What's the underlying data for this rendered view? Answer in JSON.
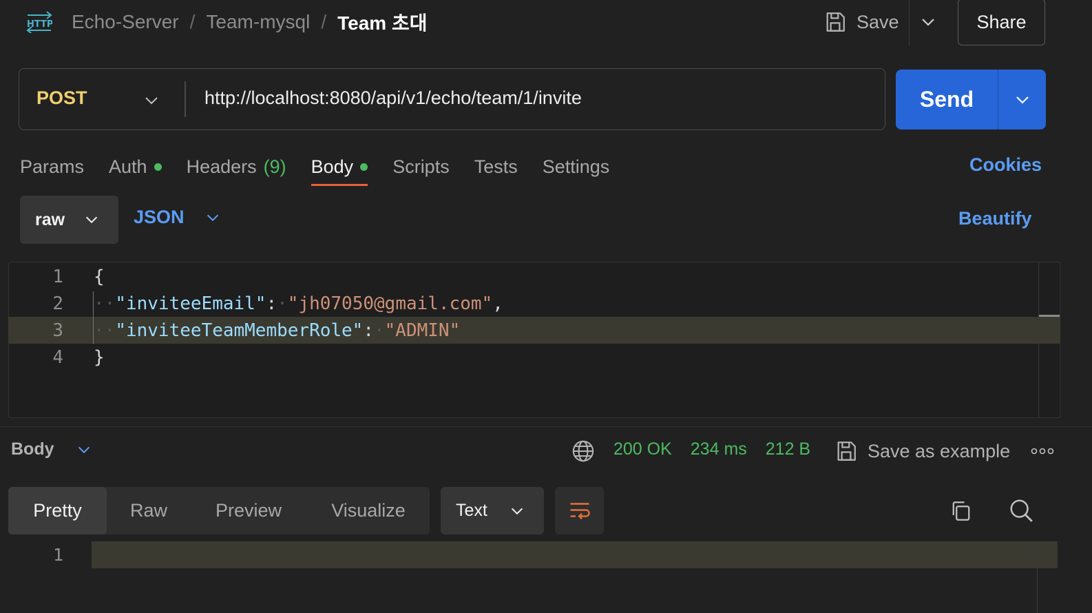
{
  "header": {
    "breadcrumb": [
      "Echo-Server",
      "Team-mysql"
    ],
    "current": "Team 초대",
    "save_label": "Save",
    "share_label": "Share",
    "icon": "http-icon"
  },
  "request": {
    "method": "POST",
    "url": "http://localhost:8080/api/v1/echo/team/1/invite",
    "send_label": "Send"
  },
  "tabs": {
    "params": "Params",
    "auth": "Auth",
    "headers": "Headers",
    "headers_count": "(9)",
    "body": "Body",
    "scripts": "Scripts",
    "tests": "Tests",
    "settings": "Settings",
    "cookies": "Cookies",
    "active": "Body"
  },
  "body_mode": {
    "type": "raw",
    "format": "JSON",
    "beautify": "Beautify"
  },
  "editor": {
    "line_numbers": [
      "1",
      "2",
      "3",
      "4"
    ],
    "open_brace": "{",
    "close_brace": "}",
    "key1": "\"inviteeEmail\"",
    "val1": "\"jh07050@gmail.com\"",
    "key2": "\"inviteeTeamMemberRole\"",
    "val2": "\"ADMIN\""
  },
  "response": {
    "section_label": "Body",
    "status": "200 OK",
    "time": "234 ms",
    "size": "212 B",
    "save_example": "Save as example",
    "view_tabs": [
      "Pretty",
      "Raw",
      "Preview",
      "Visualize"
    ],
    "active_view": "Pretty",
    "text_format": "Text",
    "line_numbers": [
      "1"
    ]
  },
  "colors": {
    "accent_blue": "#2766d8",
    "link_blue": "#5b9cf4",
    "method_yellow": "#f1cf6f",
    "success_green": "#4cbb62",
    "tab_underline": "#e8603a"
  }
}
